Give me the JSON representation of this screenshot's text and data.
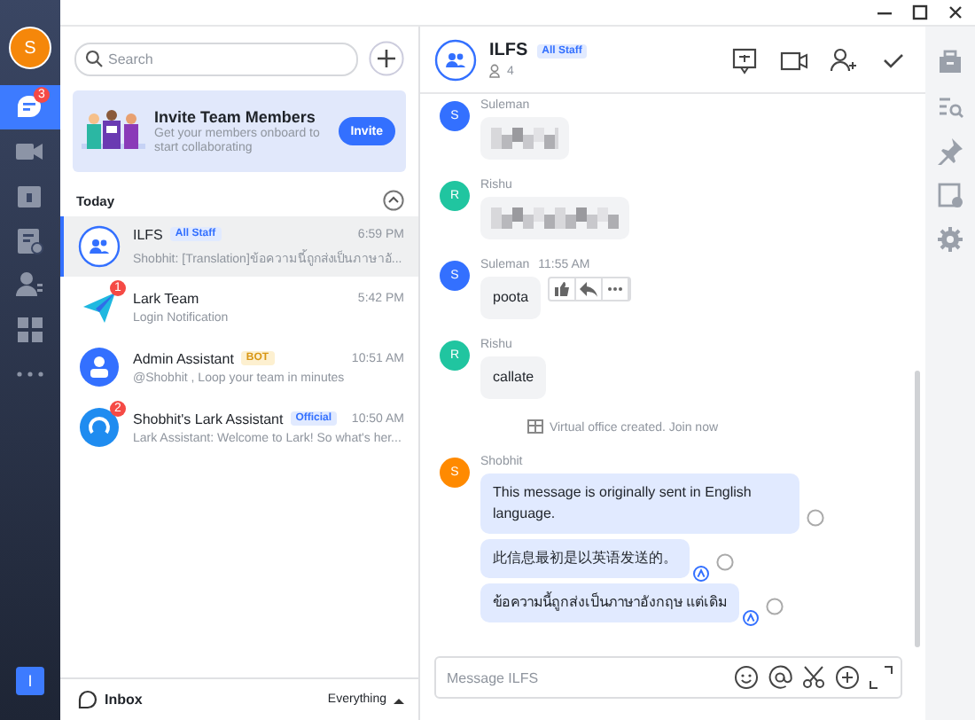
{
  "rail": {
    "avatar": "S",
    "items": [
      {
        "kind": "chat",
        "selected": true,
        "badge": "3"
      },
      {
        "kind": "video",
        "selected": false
      },
      {
        "kind": "calendar",
        "selected": false
      },
      {
        "kind": "docs",
        "selected": false
      },
      {
        "kind": "contacts",
        "selected": false
      },
      {
        "kind": "apps",
        "selected": false
      },
      {
        "kind": "more",
        "selected": false
      }
    ],
    "workspace": "I"
  },
  "search": {
    "placeholder": "Search"
  },
  "banner": {
    "title": "Invite Team Members",
    "text": "Get your members onboard to start collaborating",
    "button": "Invite"
  },
  "section": {
    "title": "Today",
    "expanded": true
  },
  "chats": [
    {
      "name": "ILFS",
      "tag": {
        "text": "All Staff",
        "kind": "staff"
      },
      "time": "6:59 PM",
      "preview": "Shobhit: [Translation]ข้อความนี้ถูกส่งเป็นภาษาอั...",
      "selected": true,
      "kind": "group"
    },
    {
      "name": "Lark Team",
      "time": "5:42 PM",
      "preview": "Login Notification",
      "selected": false,
      "badge": "1",
      "kind": "plane"
    },
    {
      "name": "Admin Assistant",
      "tag": {
        "text": "BOT",
        "kind": "bot"
      },
      "time": "10:51 AM",
      "preview": "@Shobhit , Loop your team in minutes",
      "selected": false,
      "kind": "admin"
    },
    {
      "name": "Shobhit's Lark Assistant",
      "tag": {
        "text": "Official",
        "kind": "official"
      },
      "time": "10:50 AM",
      "preview": "Lark Assistant: Welcome to Lark! So what's her...",
      "selected": false,
      "badge": "2",
      "kind": "assistant"
    }
  ],
  "inbox": {
    "label": "Inbox",
    "filter": "Everything"
  },
  "chat": {
    "title": "ILFS",
    "tag": "All Staff",
    "members": "4",
    "placeholder": "Message ILFS",
    "messages": [
      {
        "sender": "Suleman",
        "avatar": "S",
        "color": "#3370ff"
      },
      {
        "kind": "wide_image",
        "sender": "Rishu",
        "avatar": "R",
        "color": "#20c5a0"
      },
      {
        "kind": "text",
        "sender": "Suleman",
        "avatar": "S",
        "color": "#3370ff",
        "time": "11:55 AM",
        "actions": true,
        "bubbles": [
          {
            "text": "poota",
            "translated": false
          }
        ]
      },
      {
        "kind": "text",
        "sender": "Rishu",
        "avatar": "R",
        "color": "#20c5a0",
        "actions": false,
        "bubbles": [
          {
            "text": "callate",
            "translated": false
          }
        ]
      },
      {
        "kind": "system",
        "text": "Virtual office created. Join now"
      },
      {
        "kind": "text",
        "sender": "Shobhit",
        "avatar": "S",
        "color": "#ff8a00",
        "actions": false,
        "own": true,
        "bubbles": [
          {
            "text": "This message is originally sent in English language.",
            "translated": false
          },
          {
            "text": "此信息最初是以英语发送的。",
            "translated": true
          },
          {
            "text": "ข้อความนี้ถูกส่งเป็นภาษาอังกฤษ แต่เดิม",
            "translated": true
          }
        ]
      }
    ]
  }
}
